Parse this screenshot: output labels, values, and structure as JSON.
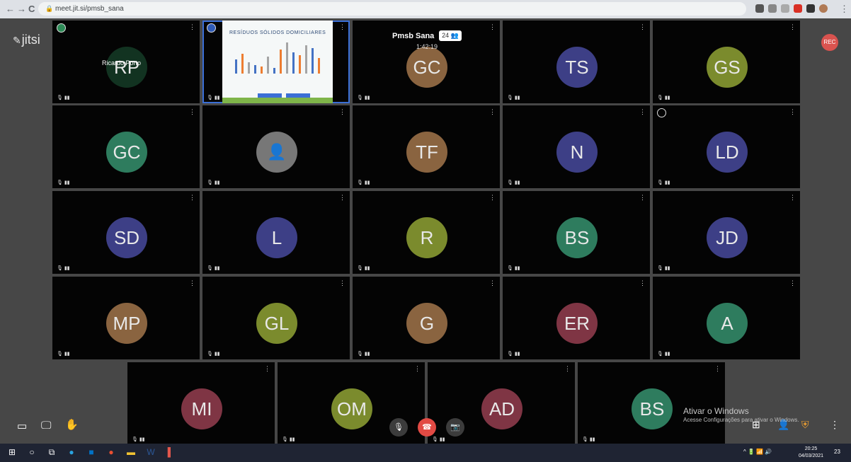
{
  "browser": {
    "url": "meet.jit.si/pmsb_sana",
    "back": "←",
    "forward": "→",
    "reload": "C"
  },
  "app": {
    "logo": "jitsi",
    "rec": "REC"
  },
  "meeting": {
    "title": "Pmsb Sana",
    "participants": "24",
    "timer": "1:42:19"
  },
  "colors": {
    "accent": "#3b6fd6",
    "hangup": "#e24a44"
  },
  "tiles": [
    {
      "initials": "RP",
      "name": "Ricardo Porto",
      "color": "#123321",
      "badge": "green"
    },
    {
      "initials": "",
      "screenshare": true,
      "badge": "blue"
    },
    {
      "initials": "GC",
      "color": "#8a6440"
    },
    {
      "initials": "TS",
      "color": "#3d3f86"
    },
    {
      "initials": "GS",
      "color": "#7b8b2d"
    },
    {
      "initials": "GC",
      "color": "#2e7c5e"
    },
    {
      "initials": "",
      "icon": "person",
      "color": "#777777"
    },
    {
      "initials": "TF",
      "color": "#8a6440"
    },
    {
      "initials": "N",
      "color": "#3d3f86"
    },
    {
      "initials": "LD",
      "color": "#3d3f86",
      "badge": "gray"
    },
    {
      "initials": "SD",
      "color": "#3d3f86"
    },
    {
      "initials": "L",
      "color": "#3d3f86"
    },
    {
      "initials": "R",
      "color": "#7b8b2d"
    },
    {
      "initials": "BS",
      "color": "#2e7c5e"
    },
    {
      "initials": "JD",
      "color": "#3d3f86"
    },
    {
      "initials": "MP",
      "color": "#8a6440"
    },
    {
      "initials": "GL",
      "color": "#7b8b2d"
    },
    {
      "initials": "G",
      "color": "#8a6440"
    },
    {
      "initials": "ER",
      "color": "#7f3544"
    },
    {
      "initials": "A",
      "color": "#2e7c5e"
    },
    {
      "initials": "MI",
      "color": "#7f3544"
    },
    {
      "initials": "OM",
      "color": "#7b8b2d"
    },
    {
      "initials": "AD",
      "color": "#7f3544"
    },
    {
      "initials": "BS",
      "color": "#2e7c5e"
    }
  ],
  "screenshare": {
    "title": "RESÍDUOS SÓLIDOS DOMICILIARES"
  },
  "watermark": {
    "line1": "Ativar o Windows",
    "line2": "Acesse Configurações para ativar o Windows."
  },
  "taskbar": {
    "time": "20:25",
    "date": "04/03/2021",
    "notif": "23"
  }
}
